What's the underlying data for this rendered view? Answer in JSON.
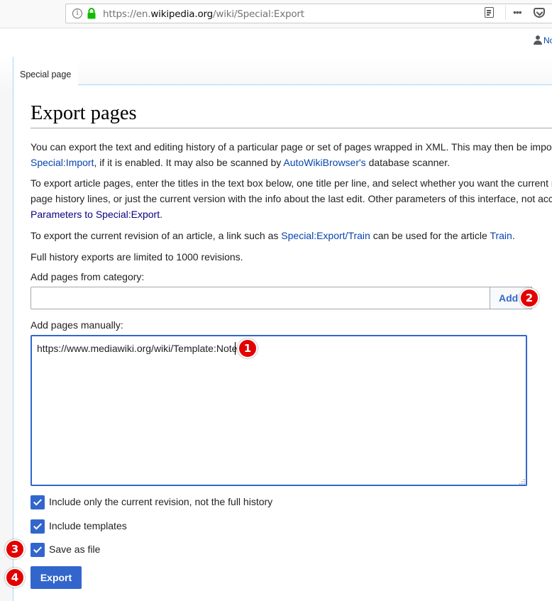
{
  "browser": {
    "url_prefix": "https://en.",
    "url_domain": "wikipedia.org",
    "url_path": "/wiki/Special:Export",
    "more_label": "•••"
  },
  "header": {
    "user_link": "Not logged in"
  },
  "tabs": [
    {
      "label": "Special page"
    }
  ],
  "page": {
    "title": "Export pages",
    "para1": {
      "line1": "You can export the text and editing history of a particular page or set of pages wrapped in XML. This may then be imported into another wiki using MediaWiki via",
      "link_import": "Special:Import",
      "text2": ", if it is enabled. It may also be scanned by ",
      "link_awb": "AutoWikiBrowser's",
      "text3": " database scanner."
    },
    "para2": {
      "line1": "To export article pages, enter the titles in the text box below, one title per line, and select whether you want the current revision as well as all old revisions, with the",
      "line2": "page history lines, or just the current version with the info about the last edit. Other parameters of this interface, not accessible through the form, are documented in",
      "link_params": "Parameters to Special:Export",
      "text_end": "."
    },
    "para3": {
      "text1": "To export the current revision of an article, a link such as ",
      "link_export_train": "Special:Export/Train",
      "text2": " can be used for the article ",
      "link_train": "Train",
      "text3": "."
    },
    "para4": "Full history exports are limited to 1000 revisions."
  },
  "form": {
    "category_label": "Add pages from category:",
    "category_value": "",
    "add_button": "Add",
    "manual_label": "Add pages manually:",
    "manual_value": "https://www.mediawiki.org/wiki/Template:Note",
    "checkboxes": [
      {
        "label": "Include only the current revision, not the full history",
        "checked": true
      },
      {
        "label": "Include templates",
        "checked": true
      },
      {
        "label": "Save as file",
        "checked": true
      }
    ],
    "export_button": "Export"
  },
  "annotations": {
    "badge1": "1",
    "badge2": "2",
    "badge3": "3",
    "badge4": "4",
    "color": "#e30000"
  }
}
